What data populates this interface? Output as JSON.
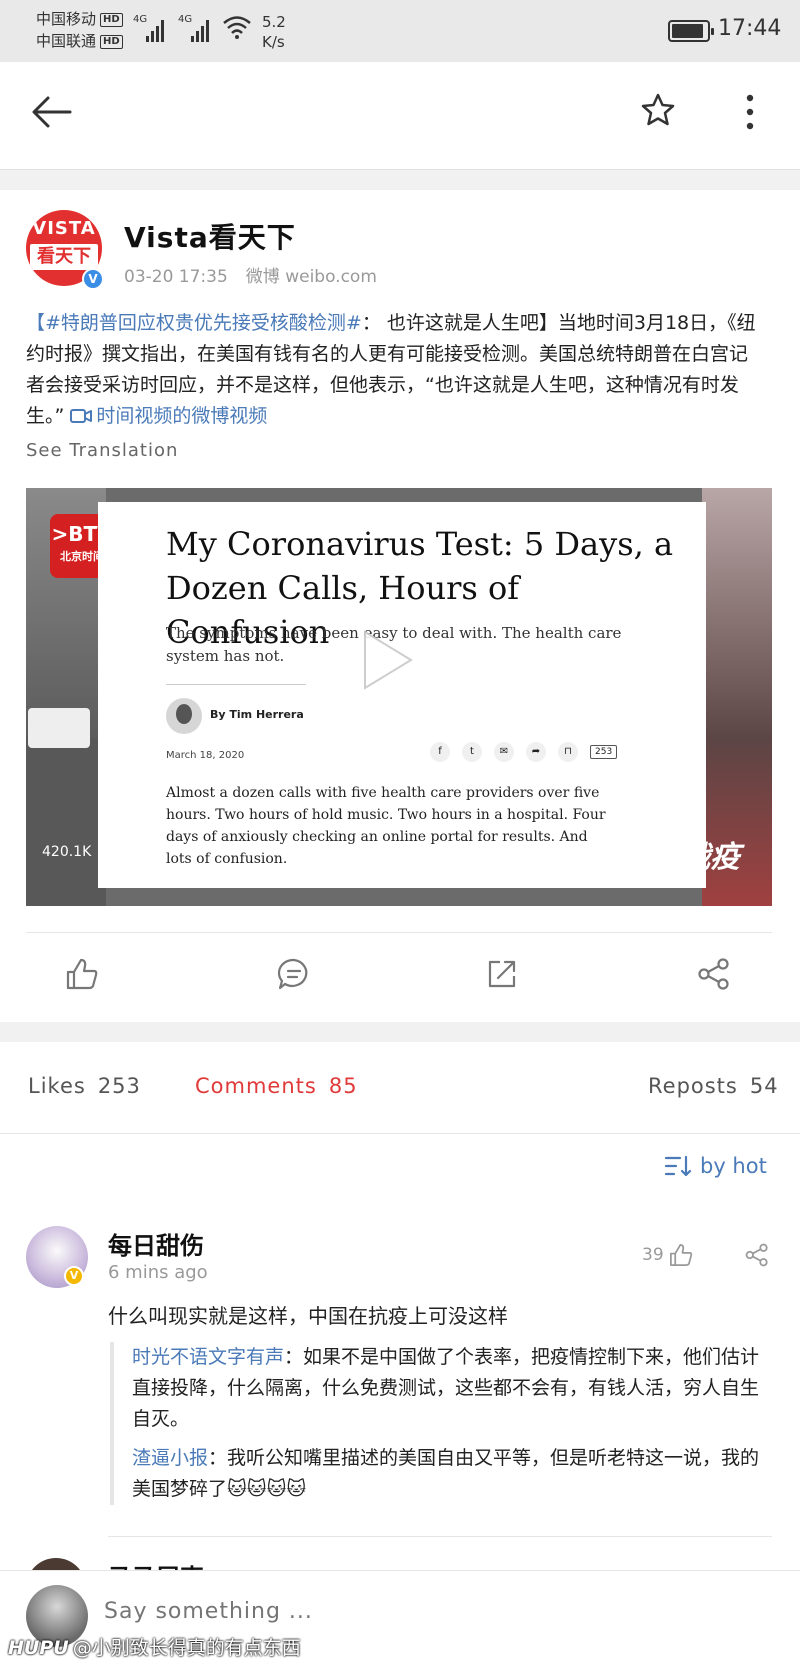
{
  "status_bar": {
    "carrier1": "中国移动",
    "carrier2": "中国联通",
    "hd": "HD",
    "net1": "4G",
    "net2": "4G",
    "speed_value": "5.2",
    "speed_unit": "K/s",
    "time": "17:44",
    "battery_level": 0.9
  },
  "top_bar": {
    "back_icon": "arrow-left-icon",
    "favorite_icon": "star-icon",
    "more_icon": "more-vertical-icon"
  },
  "post": {
    "author": "Vista看天下",
    "avatar_line1": "VISTA",
    "avatar_line2": "看天下",
    "timestamp": "03-20 17:35",
    "source": "微博 weibo.com",
    "hashtag": "【#特朗普回应权贵优先接受核酸检测#",
    "body": "： 也许这就是人生吧】当地时间3月18日，《纽约时报》撰文指出，在美国有钱有名的人更有可能接受检测。美国总统特朗普在白宫记者会接受采访时回应，并不是这样，但他表示，“也许这就是人生吧，这种情况有时发生。”",
    "video_link": "时间视频的微博视频",
    "see_translation": "See Translation"
  },
  "video": {
    "channel_badge": ">BTV",
    "channel_sub": "北京时间",
    "article_title": "My Coronavirus Test: 5 Days, a Dozen Calls, Hours of Confusion",
    "article_subtitle": "The symptoms have been easy to deal with. The health care system has not.",
    "byline": "By Tim Herrera",
    "date": "March 18, 2020",
    "comment_count": "253",
    "article_body": "Almost a dozen calls with five health care providers over five hours. Two hours of hold music. Two hours in a hospital. Four days of anxiously checking an online portal for results. And lots of confusion.",
    "views": "420.1K",
    "stamp": "战疫"
  },
  "actions": [
    "like-icon",
    "comment-icon",
    "forward-icon",
    "share-icon"
  ],
  "tabs": {
    "likes_label": "Likes",
    "likes_count": "253",
    "comments_label": "Comments",
    "comments_count": "85",
    "reposts_label": "Reposts",
    "reposts_count": "54"
  },
  "sort_label": "by hot",
  "comment": {
    "name": "每日甜伤",
    "time": "6 mins ago",
    "likes": "39",
    "text": "什么叫现实就是这样，中国在抗疫上可没这样",
    "replies": [
      {
        "user": "时光不语文字有声",
        "text": "：如果不是中国做了个表率，把疫情控制下来，他们估计直接投降，什么隔离，什么免费测试，这些都不会有，有钱人活，穷人自生自灭。"
      },
      {
        "user": "渣逼小报",
        "text": "：我听公知嘴里描述的美国自由又平等，但是听老特这一说，我的美国梦碎了🐱🐱🐱🐱"
      }
    ],
    "next_name_peek": "马马尾声"
  },
  "input": {
    "placeholder": "Say something ..."
  },
  "watermark": {
    "brand": "HUPU",
    "text": "@小别致长得真的有点东西"
  }
}
